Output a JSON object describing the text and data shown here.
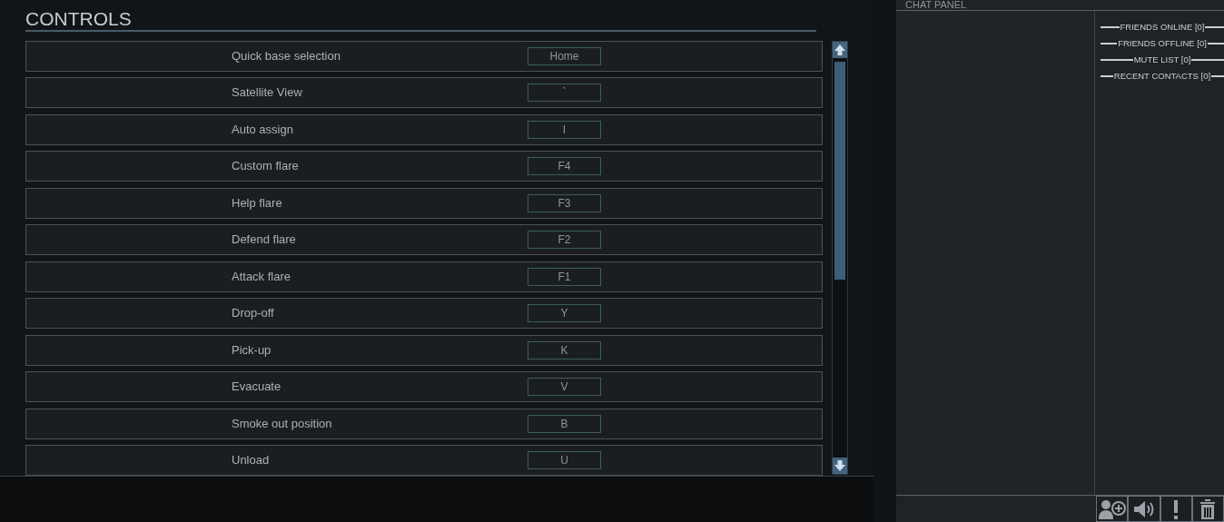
{
  "controls": {
    "title": "CONTROLS",
    "rows": [
      {
        "action": "Quick base selection",
        "key": "Home"
      },
      {
        "action": "Satellite View",
        "key": "`"
      },
      {
        "action": "Auto assign",
        "key": "I"
      },
      {
        "action": "Custom flare",
        "key": "F4"
      },
      {
        "action": "Help flare",
        "key": "F3"
      },
      {
        "action": "Defend flare",
        "key": "F2"
      },
      {
        "action": "Attack flare",
        "key": "F1"
      },
      {
        "action": "Drop-off",
        "key": "Y"
      },
      {
        "action": "Pick-up",
        "key": "K"
      },
      {
        "action": "Evacuate",
        "key": "V"
      },
      {
        "action": "Smoke out position",
        "key": "B"
      },
      {
        "action": "Unload",
        "key": "U"
      }
    ]
  },
  "chat_panel": {
    "title": "CHAT PANEL",
    "lists": [
      "FRIENDS ONLINE [0]",
      "FRIENDS OFFLINE [0]",
      "MUTE LIST [0]",
      "RECENT CONTACTS [0]"
    ]
  }
}
